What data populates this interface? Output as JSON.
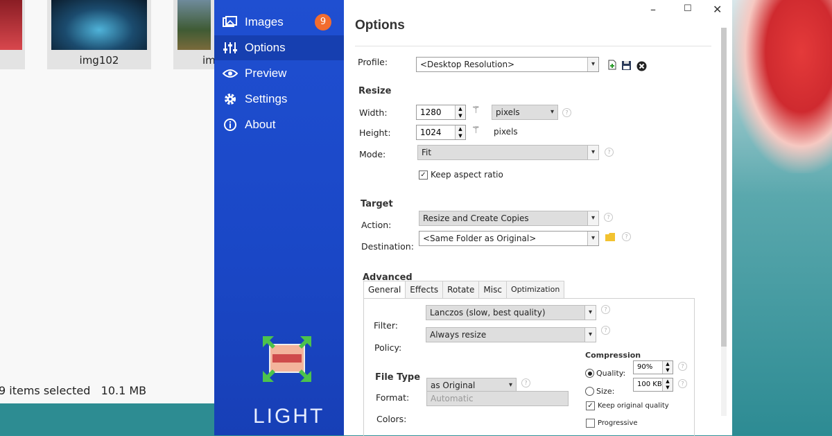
{
  "explorer": {
    "thumbnails": [
      {
        "label": ""
      },
      {
        "label": "img102"
      },
      {
        "label": "im"
      }
    ],
    "status_count": "9 items selected",
    "status_size": "10.1 MB"
  },
  "sidebar": {
    "items": [
      {
        "label": "Images",
        "icon": "images-icon"
      },
      {
        "label": "Options",
        "icon": "sliders-icon"
      },
      {
        "label": "Preview",
        "icon": "eye-icon"
      },
      {
        "label": "Settings",
        "icon": "gear-icon"
      },
      {
        "label": "About",
        "icon": "info-icon"
      }
    ],
    "images_badge": "9",
    "brand": "LIGHT"
  },
  "window": {
    "minimize": "–",
    "maximize": "☐",
    "close": "✕"
  },
  "options": {
    "title": "Options",
    "profile_label": "Profile:",
    "profile_value": "<Desktop Resolution>",
    "resize_heading": "Resize",
    "width_label": "Width:",
    "width_value": "1280",
    "width_unit": "pixels",
    "height_label": "Height:",
    "height_value": "1024",
    "height_unit": "pixels",
    "mode_label": "Mode:",
    "mode_value": "Fit",
    "keep_aspect_label": "Keep aspect ratio",
    "target_heading": "Target",
    "action_label": "Action:",
    "action_value": "Resize and Create Copies",
    "destination_label": "Destination:",
    "destination_value": "<Same Folder as Original>",
    "advanced_heading": "Advanced",
    "tabs": [
      "General",
      "Effects",
      "Rotate",
      "Misc",
      "Optimization"
    ],
    "filter_label": "Filter:",
    "filter_value": "Lanczos  (slow, best quality)",
    "policy_label": "Policy:",
    "policy_value": "Always resize",
    "filetype_heading": "File Type",
    "format_label": "Format:",
    "format_value": "as Original",
    "colors_label": "Colors:",
    "colors_value": "Automatic",
    "compression_heading": "Compression",
    "quality_label": "Quality:",
    "quality_value": "90%",
    "size_label": "Size:",
    "size_value": "100 KB",
    "keep_quality_label": "Keep original quality",
    "progressive_label": "Progressive"
  },
  "colors": {
    "sidebar": "#1f4fd1",
    "badge": "#f26c2f"
  }
}
